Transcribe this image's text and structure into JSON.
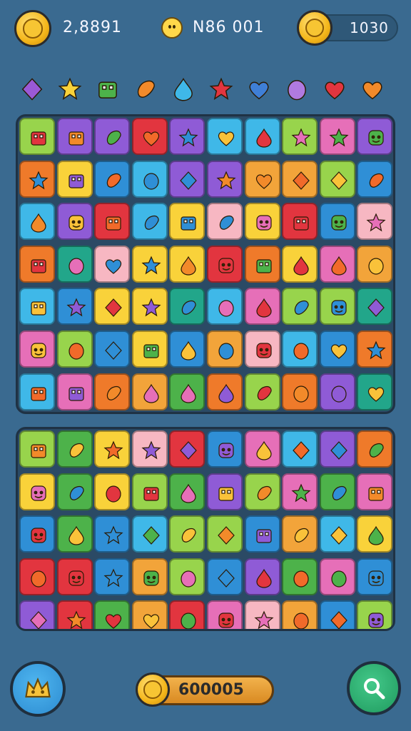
{
  "top": {
    "score": "2,8891",
    "middle_value": "N86 001",
    "gold_value": "1030"
  },
  "legend_gems": [
    "diamond-purple",
    "star-yellow",
    "block-green",
    "drop-orange",
    "drop-blue",
    "star-red",
    "heart-blue",
    "blob-purple",
    "heart-red",
    "heart-orange"
  ],
  "bottom": {
    "bar_value": "600005"
  },
  "colors": {
    "background": "#3a6a90",
    "board": "#2b4a65",
    "gold": "#f4b61a",
    "search_button": "#27a56a"
  }
}
